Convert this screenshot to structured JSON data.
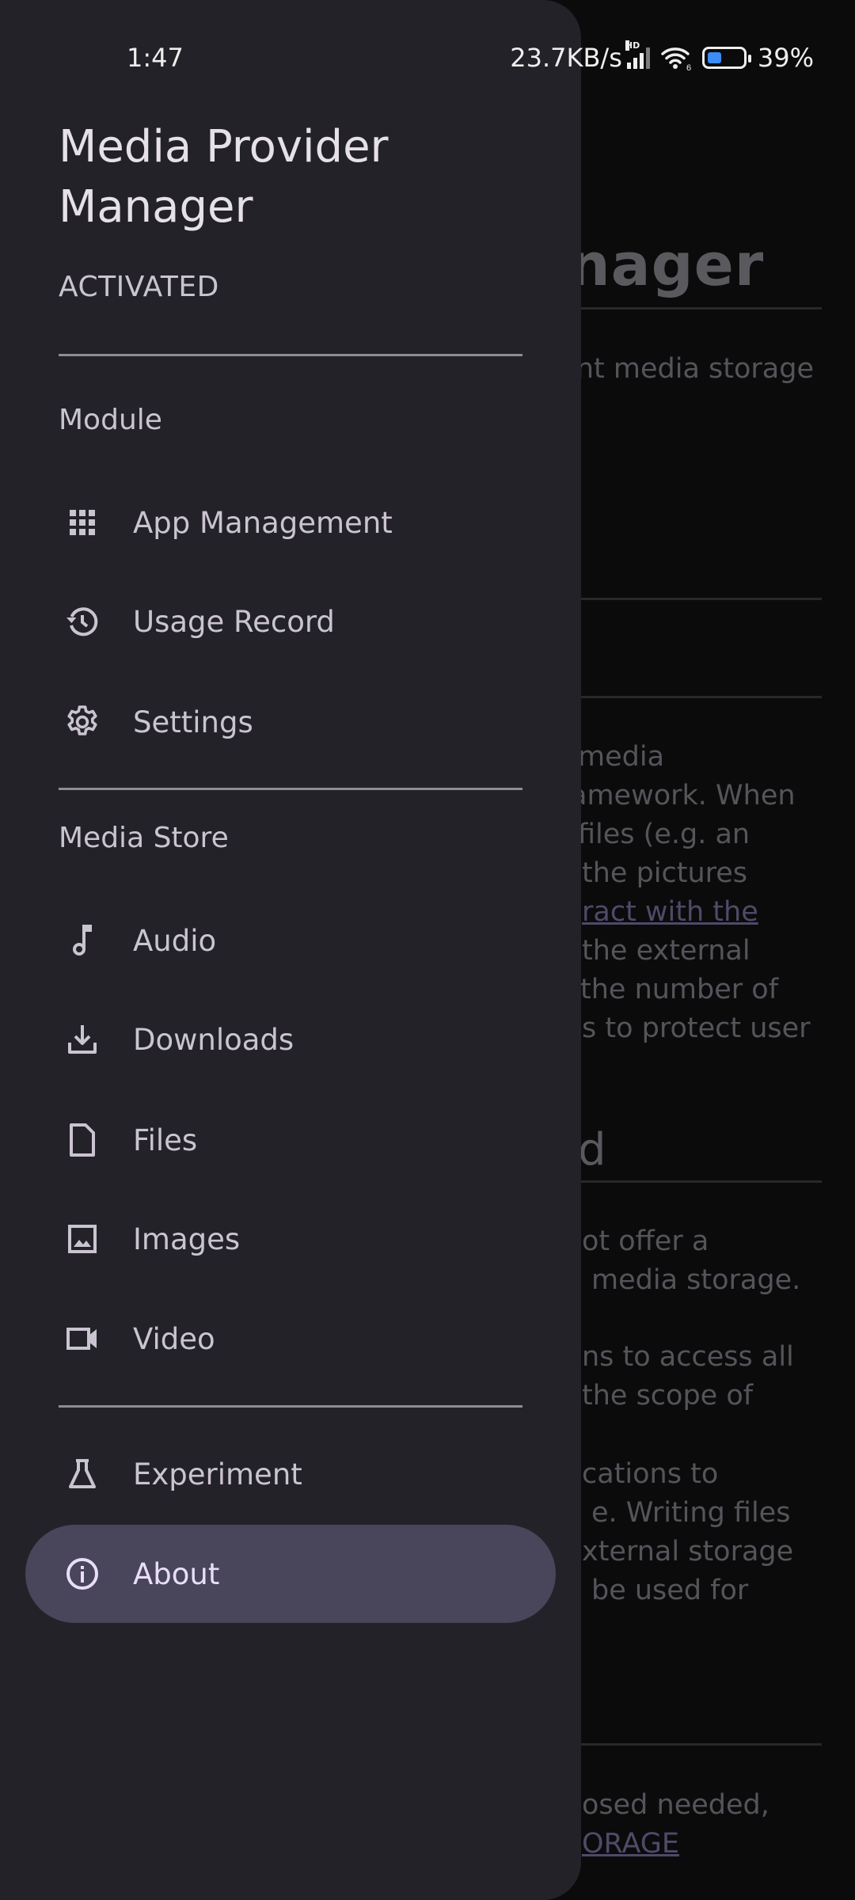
{
  "status_bar": {
    "time": "1:47",
    "net_speed": "23.7KB/s",
    "signal_badge": "HD",
    "wifi_badge": "6",
    "battery_percent": "39%",
    "battery_level": 0.39
  },
  "drawer": {
    "app_title": "Media Provider Manager",
    "app_status": "ACTIVATED",
    "sections": [
      {
        "title": "Module",
        "items": [
          {
            "label": "App Management",
            "icon": "apps-grid-icon"
          },
          {
            "label": "Usage Record",
            "icon": "history-icon"
          },
          {
            "label": "Settings",
            "icon": "gear-icon"
          }
        ]
      },
      {
        "title": "Media Store",
        "items": [
          {
            "label": "Audio",
            "icon": "music-note-icon"
          },
          {
            "label": "Downloads",
            "icon": "download-icon"
          },
          {
            "label": "Files",
            "icon": "file-icon"
          },
          {
            "label": "Images",
            "icon": "image-icon"
          },
          {
            "label": "Video",
            "icon": "video-camera-icon"
          }
        ]
      },
      {
        "title": "",
        "items": [
          {
            "label": "Experiment",
            "icon": "flask-icon"
          },
          {
            "label": "About",
            "icon": "info-icon",
            "active": true
          }
        ]
      }
    ]
  },
  "background_page": {
    "title_fragment": "nager",
    "subtitle_fragment": "nt media storage",
    "para1": [
      "media",
      "amework. When",
      "files (e.g. an",
      "the pictures",
      "ract with the",
      "the external",
      "the number of",
      "s to protect user"
    ],
    "para1_link_line_index": 4,
    "heading2_fragment": "d",
    "para2": [
      "ot offer a",
      "media storage."
    ],
    "para3": [
      "ns to access all",
      "the scope of"
    ],
    "para4": [
      "cations to",
      "e. Writing files",
      "xternal storage",
      "be used for"
    ],
    "para5_line1": "osed needed,",
    "para5_link": "ORAGE"
  },
  "colors": {
    "drawer_bg": "#232228",
    "page_bg": "#0b0b0c",
    "active_item_bg": "#49455a",
    "text_primary": "#e6e1e8",
    "text_secondary": "#cac4d0",
    "battery_fill": "#3a8ef6"
  }
}
